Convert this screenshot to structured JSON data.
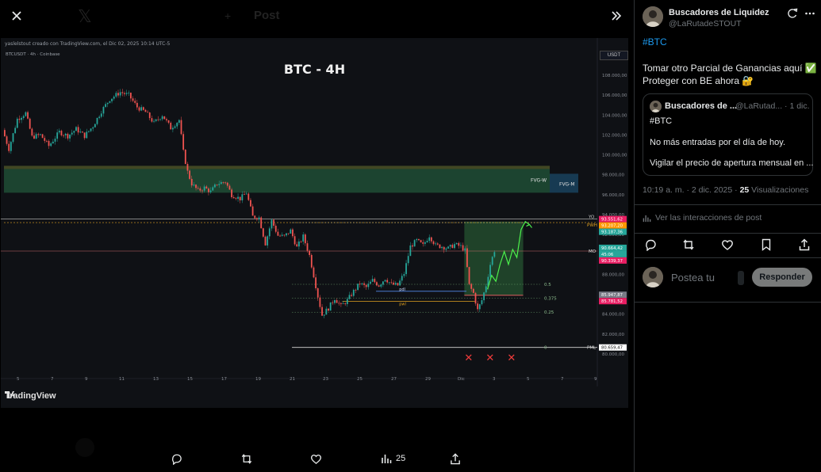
{
  "viewer": {
    "ghost_title": "Post",
    "actions": {
      "reply_count": "",
      "repost_count": "",
      "like_count": "",
      "views_count": "25"
    }
  },
  "chart": {
    "caption": "yaslelstout creado con TradingView.com, el Dic 02, 2025 10:14 UTC-5",
    "symbol_line": "BTCUSDT · 4h · Coinbase",
    "currency": "USDT",
    "title": "BTC - 4H",
    "brand": "TradingView",
    "zone_labels": {
      "fvg_w": "FVG-W",
      "fvg_m": "FVG-M"
    },
    "level_labels": {
      "yo": "YO",
      "pwh": "PWH",
      "mo": "MO",
      "pml": "PML",
      "pdl": "pdl",
      "pwl": "pwl"
    },
    "fib_labels": [
      "0.5",
      "0.375",
      "0.25",
      "0"
    ],
    "price_tags": [
      {
        "text": "93.551,62",
        "color": "#e91e63"
      },
      {
        "text": "93.207,20",
        "color": "#ff9800"
      },
      {
        "text": "93.187,36",
        "color": "#26a69a"
      },
      {
        "text": "90.664,42",
        "color": "#26a69a"
      },
      {
        "text": "45:06",
        "color": "#26a69a"
      },
      {
        "text": "90.339,37",
        "color": "#e91e63"
      },
      {
        "text": "85.947,87",
        "color": "#787b86"
      },
      {
        "text": "85.781,52",
        "color": "#e91e63"
      },
      {
        "text": "80.659,47",
        "color": "#ffffff"
      }
    ],
    "y_axis": [
      "108.000,00",
      "106.000,00",
      "104.000,00",
      "102.000,00",
      "100.000,00",
      "98.000,00",
      "96.000,00",
      "94.000,00",
      "92.000,00",
      "90.000,00",
      "88.000,00",
      "86.000,00",
      "84.000,00",
      "82.000,00",
      "80.000,00"
    ],
    "x_axis": [
      "5",
      "7",
      "9",
      "11",
      "13",
      "15",
      "17",
      "19",
      "21",
      "23",
      "25",
      "27",
      "29",
      "Dic",
      "3",
      "5",
      "7",
      "9"
    ],
    "marks": "✕ ✕ ✕"
  },
  "chart_data": {
    "type": "candlestick",
    "title": "BTC - 4H",
    "ylim": [
      79000,
      109000
    ],
    "x_ticks": [
      "5",
      "7",
      "9",
      "11",
      "13",
      "15",
      "17",
      "19",
      "21",
      "23",
      "25",
      "27",
      "29",
      "Dic",
      "3",
      "5",
      "7",
      "9"
    ],
    "close_path": [
      [
        0,
        102500
      ],
      [
        3,
        100600
      ],
      [
        7,
        103600
      ],
      [
        11,
        104200
      ],
      [
        14,
        101800
      ],
      [
        18,
        102000
      ],
      [
        22,
        100900
      ],
      [
        27,
        102300
      ],
      [
        31,
        101900
      ],
      [
        35,
        102600
      ],
      [
        39,
        101900
      ],
      [
        43,
        102900
      ],
      [
        47,
        104400
      ],
      [
        51,
        105600
      ],
      [
        56,
        106300
      ],
      [
        60,
        106000
      ],
      [
        64,
        104800
      ],
      [
        68,
        104300
      ],
      [
        72,
        103200
      ],
      [
        76,
        104000
      ],
      [
        80,
        102700
      ],
      [
        84,
        103500
      ],
      [
        86,
        100300
      ],
      [
        88,
        98300
      ],
      [
        90,
        97100
      ],
      [
        93,
        96400
      ],
      [
        96,
        96700
      ],
      [
        99,
        96300
      ],
      [
        102,
        97100
      ],
      [
        106,
        97300
      ],
      [
        109,
        96000
      ],
      [
        113,
        95600
      ],
      [
        116,
        96200
      ],
      [
        119,
        93800
      ],
      [
        122,
        93700
      ],
      [
        125,
        91100
      ],
      [
        128,
        93400
      ],
      [
        131,
        91900
      ],
      [
        134,
        91800
      ],
      [
        137,
        92400
      ],
      [
        140,
        90700
      ],
      [
        143,
        91800
      ],
      [
        146,
        89900
      ],
      [
        148,
        87900
      ],
      [
        150,
        85800
      ],
      [
        152,
        83900
      ],
      [
        155,
        84600
      ],
      [
        158,
        85600
      ],
      [
        161,
        84800
      ],
      [
        164,
        85400
      ],
      [
        167,
        86300
      ],
      [
        170,
        87100
      ],
      [
        173,
        86700
      ],
      [
        176,
        87400
      ],
      [
        179,
        86900
      ],
      [
        182,
        87600
      ],
      [
        185,
        87000
      ],
      [
        188,
        86900
      ],
      [
        191,
        88100
      ],
      [
        194,
        90800
      ],
      [
        197,
        91400
      ],
      [
        200,
        90900
      ],
      [
        203,
        91900
      ],
      [
        206,
        90900
      ],
      [
        209,
        90800
      ],
      [
        212,
        90600
      ],
      [
        215,
        91000
      ],
      [
        218,
        90800
      ],
      [
        220,
        90400
      ],
      [
        222,
        86900
      ],
      [
        224,
        86100
      ],
      [
        226,
        84400
      ],
      [
        228,
        85400
      ],
      [
        230,
        86900
      ],
      [
        232,
        89000
      ],
      [
        234,
        90400
      ]
    ],
    "projection": [
      [
        230,
        86500
      ],
      [
        232,
        87900
      ],
      [
        234,
        87300
      ],
      [
        236,
        89000
      ],
      [
        238,
        90300
      ],
      [
        240,
        89000
      ],
      [
        242,
        90500
      ],
      [
        244,
        89700
      ],
      [
        246,
        92500
      ],
      [
        248,
        93300
      ],
      [
        250,
        93000
      ]
    ],
    "fib_levels": [
      {
        "label": "0.5",
        "value": 87000
      },
      {
        "label": "0.375",
        "value": 85600
      },
      {
        "label": "0.25",
        "value": 84200
      },
      {
        "label": "0",
        "value": 80660
      }
    ],
    "zones": [
      {
        "label": "FVG-W",
        "from": 96200,
        "to": 98900
      },
      {
        "label": "FVG-M",
        "from": 96200,
        "to": 98900
      }
    ],
    "levels": [
      {
        "label": "YO",
        "value": 93550
      },
      {
        "label": "PWH",
        "value": 93200
      },
      {
        "label": "MO",
        "value": 90340
      },
      {
        "label": "PML",
        "value": 80660
      }
    ]
  },
  "panel": {
    "author_name": "Buscadores de Liquidez",
    "author_handle": "@LaRutadeSTOUT",
    "hashtag": "#BTC",
    "body_lines": [
      "Tomar otro Parcial de Ganancias aquí ✅",
      "Proteger con BE ahora 🔐"
    ],
    "quote": {
      "name": "Buscadores de ...",
      "handle": "@LaRutad... · 1 dic.",
      "tag": "#BTC",
      "line1": "No más entradas por el día de hoy.",
      "line2": "Vigilar el precio de apertura mensual en ..."
    },
    "meta_time": "10:19 a. m. · 2 dic. 2025 · ",
    "meta_views": "25",
    "meta_views_label": " Visualizaciones",
    "interactions": "Ver las interacciones de post",
    "reply_placeholder": "Postea tu",
    "reply_button": "Responder"
  }
}
